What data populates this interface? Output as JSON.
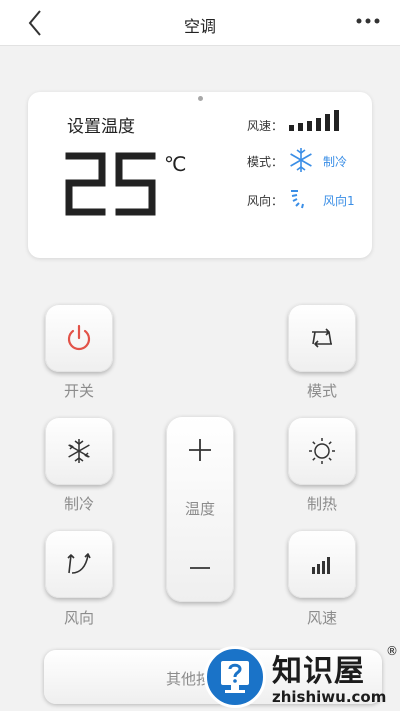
{
  "header": {
    "title": "空调",
    "back_icon": "chevron-left-icon",
    "more_icon": "more-dots-icon"
  },
  "status_card": {
    "set_temp_label": "设置温度",
    "temperature": "25",
    "unit": "℃",
    "fan_speed": {
      "label": "风速：",
      "level": 6,
      "max_level": 6
    },
    "mode": {
      "label": "模式：",
      "value": "制冷",
      "icon": "snowflake-icon"
    },
    "wind_direction": {
      "label": "风向：",
      "value": "风向1",
      "icon": "wind-direction-icon"
    }
  },
  "controls": {
    "power": {
      "label": "开关",
      "icon": "power-icon"
    },
    "mode": {
      "label": "模式",
      "icon": "mode-switch-icon"
    },
    "cool": {
      "label": "制冷",
      "icon": "snowflake-icon"
    },
    "heat": {
      "label": "制热",
      "icon": "sun-icon"
    },
    "direction": {
      "label": "风向",
      "icon": "wind-direction-icon"
    },
    "speed": {
      "label": "风速",
      "icon": "signal-bars-icon"
    },
    "temperature": {
      "label": "温度",
      "increase_icon": "plus-icon",
      "decrease_icon": "minus-icon"
    }
  },
  "other_button": {
    "label": "其他按"
  },
  "watermark": {
    "title": "知识屋",
    "registered": "®",
    "subtitle": "zhishiwu.com"
  },
  "colors": {
    "accent": "#3a8ee6",
    "power": "#e25248",
    "background": "#f2f2f2",
    "watermark_blue": "#1a73c8"
  }
}
